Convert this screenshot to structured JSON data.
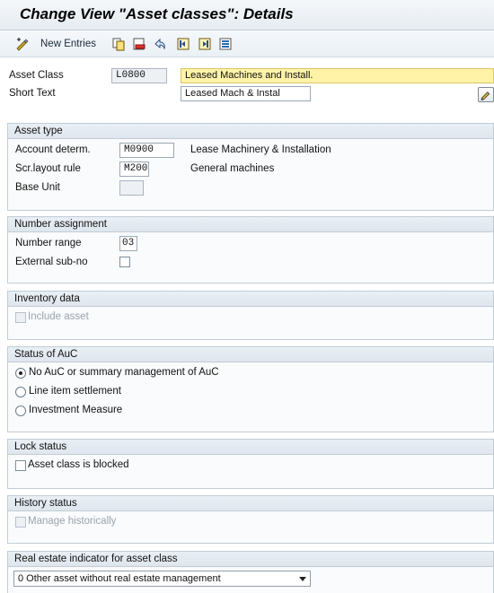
{
  "title": "Change View \"Asset classes\": Details",
  "toolbar": {
    "new_entries_label": "New Entries",
    "icons": [
      "display-change-icon",
      "copy-icon",
      "delete-icon",
      "undo-icon",
      "previous-entry-icon",
      "next-entry-icon",
      "select-all-icon"
    ]
  },
  "header": {
    "asset_class_label": "Asset Class",
    "asset_class_value": "L0800",
    "asset_class_desc": "Leased Machines and Install.",
    "short_text_label": "Short Text",
    "short_text_value": "Leased Mach & Instal"
  },
  "asset_type": {
    "title": "Asset type",
    "account_determ_label": "Account determ.",
    "account_determ_value": "M0900",
    "account_determ_desc": "Lease Machinery & Installation",
    "scr_layout_label": "Scr.layout rule",
    "scr_layout_value": "M200",
    "scr_layout_desc": "General machines",
    "base_unit_label": "Base Unit",
    "base_unit_value": ""
  },
  "number_assignment": {
    "title": "Number assignment",
    "number_range_label": "Number range",
    "number_range_value": "03",
    "external_subno_label": "External sub-no"
  },
  "inventory_data": {
    "title": "Inventory data",
    "include_asset_label": "Include asset"
  },
  "status_auc": {
    "title": "Status of AuC",
    "options": [
      "No AuC or summary management of AuC",
      "Line item settlement",
      "Investment Measure"
    ],
    "selected": 0
  },
  "lock_status": {
    "title": "Lock status",
    "blocked_label": "Asset class is blocked"
  },
  "history_status": {
    "title": "History status",
    "manage_label": "Manage historically"
  },
  "real_estate": {
    "title": "Real estate indicator for asset class",
    "selected_value": "0 Other asset without real estate management"
  }
}
